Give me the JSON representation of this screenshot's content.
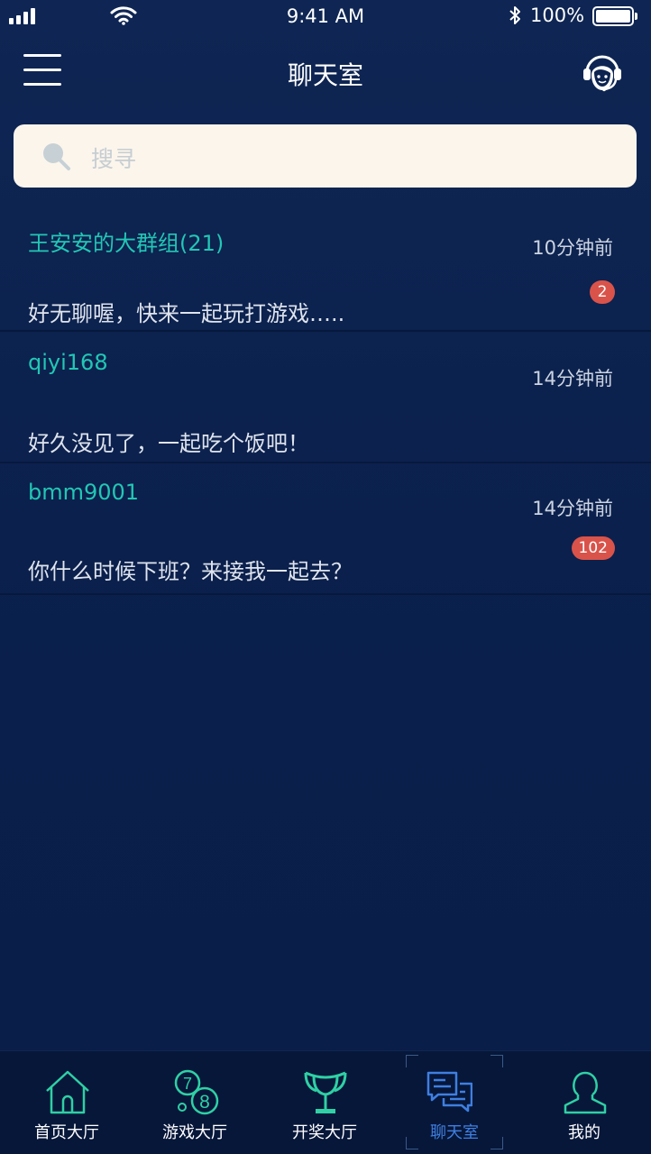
{
  "status_bar": {
    "time": "9:41 AM",
    "battery": "100%"
  },
  "nav": {
    "title": "聊天室",
    "menu_icon": "menu-icon",
    "support_icon": "customer-service-icon"
  },
  "search": {
    "placeholder": "搜寻"
  },
  "chats": [
    {
      "name": "王安安的大群组(21)",
      "time": "10分钟前",
      "message": "好无聊喔，快来一起玩打游戏…..",
      "badge": "2"
    },
    {
      "name": "qiyi168",
      "time": "14分钟前",
      "message": "好久没见了，一起吃个饭吧！",
      "badge": ""
    },
    {
      "name": "bmm9001",
      "time": "14分钟前",
      "message": "你什么时候下班？来接我一起去？",
      "badge": "102"
    }
  ],
  "tabs": [
    {
      "label": "首页大厅",
      "icon": "home-icon"
    },
    {
      "label": "游戏大厅",
      "icon": "lottery-balls-icon"
    },
    {
      "label": "开奖大厅",
      "icon": "trophy-icon"
    },
    {
      "label": "聊天室",
      "icon": "chat-icon",
      "active": true
    },
    {
      "label": "我的",
      "icon": "user-icon"
    }
  ],
  "colors": {
    "accent": "#22c7b5",
    "active_tab": "#3f7fe0",
    "badge": "#d9534a",
    "background": "#0b1f4a"
  }
}
